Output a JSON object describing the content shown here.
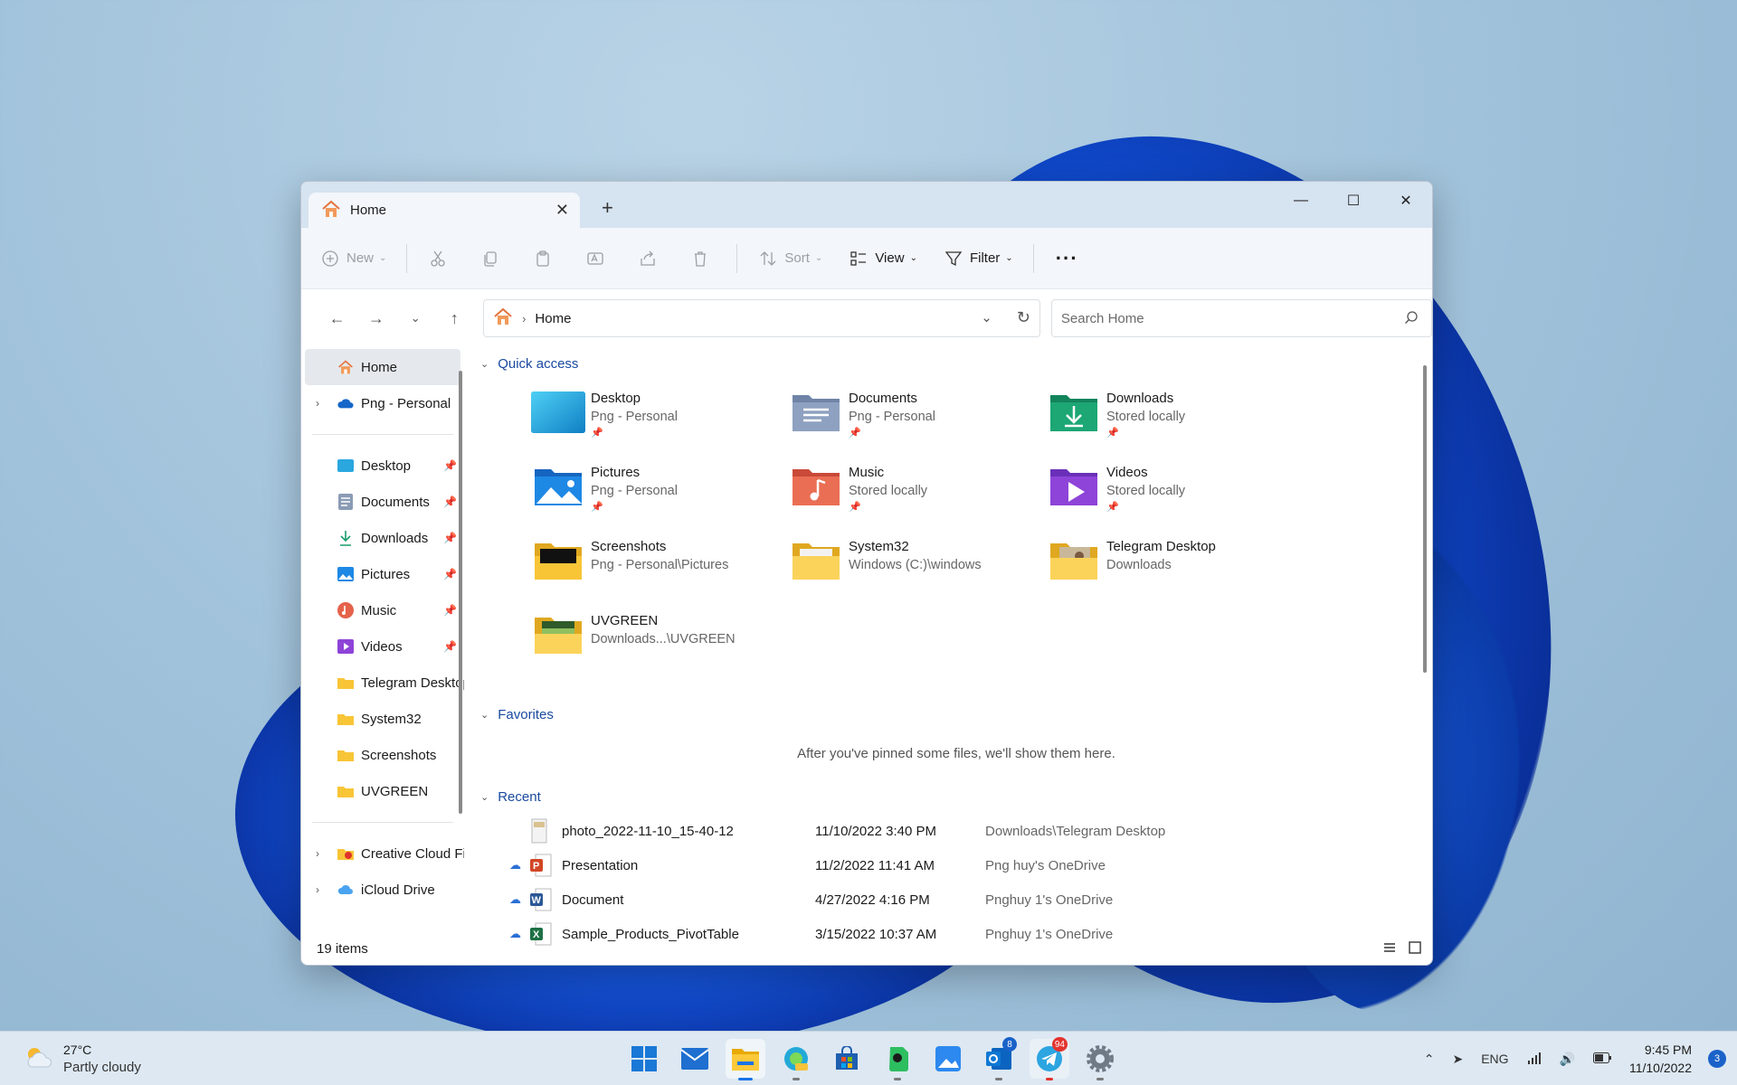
{
  "window": {
    "tab_title": "Home",
    "new_tab": "+"
  },
  "toolbar": {
    "new_label": "New",
    "sort_label": "Sort",
    "view_label": "View",
    "filter_label": "Filter",
    "more_label": "···"
  },
  "address": {
    "crumb": "Home",
    "search_placeholder": "Search Home"
  },
  "sidebar": {
    "home": "Home",
    "onedrive": "Png - Personal",
    "pinned": [
      {
        "label": "Desktop",
        "icon": "desktop-icon"
      },
      {
        "label": "Documents",
        "icon": "documents-icon"
      },
      {
        "label": "Downloads",
        "icon": "downloads-icon"
      },
      {
        "label": "Pictures",
        "icon": "pictures-icon"
      },
      {
        "label": "Music",
        "icon": "music-icon"
      },
      {
        "label": "Videos",
        "icon": "videos-icon"
      }
    ],
    "folders": [
      "Telegram Desktop",
      "System32",
      "Screenshots",
      "UVGREEN"
    ],
    "cloud": [
      "Creative Cloud Files",
      "iCloud Drive"
    ]
  },
  "main": {
    "quick_access_title": "Quick access",
    "quick_access": [
      {
        "name": "Desktop",
        "sub": "Png - Personal",
        "pinned": true
      },
      {
        "name": "Documents",
        "sub": "Png - Personal",
        "pinned": true
      },
      {
        "name": "Downloads",
        "sub": "Stored locally",
        "pinned": true
      },
      {
        "name": "Pictures",
        "sub": "Png - Personal",
        "pinned": true
      },
      {
        "name": "Music",
        "sub": "Stored locally",
        "pinned": true
      },
      {
        "name": "Videos",
        "sub": "Stored locally",
        "pinned": true
      },
      {
        "name": "Screenshots",
        "sub": "Png - Personal\\Pictures",
        "pinned": false
      },
      {
        "name": "System32",
        "sub": "Windows (C:)\\windows",
        "pinned": false
      },
      {
        "name": "Telegram Desktop",
        "sub": "Downloads",
        "pinned": false
      },
      {
        "name": "UVGREEN",
        "sub": "Downloads...\\UVGREEN",
        "pinned": false
      }
    ],
    "favorites_title": "Favorites",
    "favorites_empty": "After you've pinned some files, we'll show them here.",
    "recent_title": "Recent",
    "recent": [
      {
        "name": "photo_2022-11-10_15-40-12",
        "date": "11/10/2022 3:40 PM",
        "location": "Downloads\\Telegram Desktop",
        "cloud": false,
        "type": "image"
      },
      {
        "name": "Presentation",
        "date": "11/2/2022 11:41 AM",
        "location": "Png huy's OneDrive",
        "cloud": true,
        "type": "powerpoint"
      },
      {
        "name": "Document",
        "date": "4/27/2022 4:16 PM",
        "location": "Pnghuy 1's OneDrive",
        "cloud": true,
        "type": "word"
      },
      {
        "name": "Sample_Products_PivotTable",
        "date": "3/15/2022 10:37 AM",
        "location": "Pnghuy 1's OneDrive",
        "cloud": true,
        "type": "excel"
      }
    ]
  },
  "status": {
    "item_count": "19 items"
  },
  "taskbar": {
    "temp": "27°C",
    "condition": "Partly cloudy",
    "mail_badge": "8",
    "telegram_badge": "94",
    "lang": "ENG",
    "time": "9:45 PM",
    "date": "11/10/2022",
    "notifications": "3"
  },
  "colors": {
    "accent": "#1a4aa0",
    "folder_yellow": "#f8c537",
    "taskbar_bg": "#dde8f2"
  }
}
